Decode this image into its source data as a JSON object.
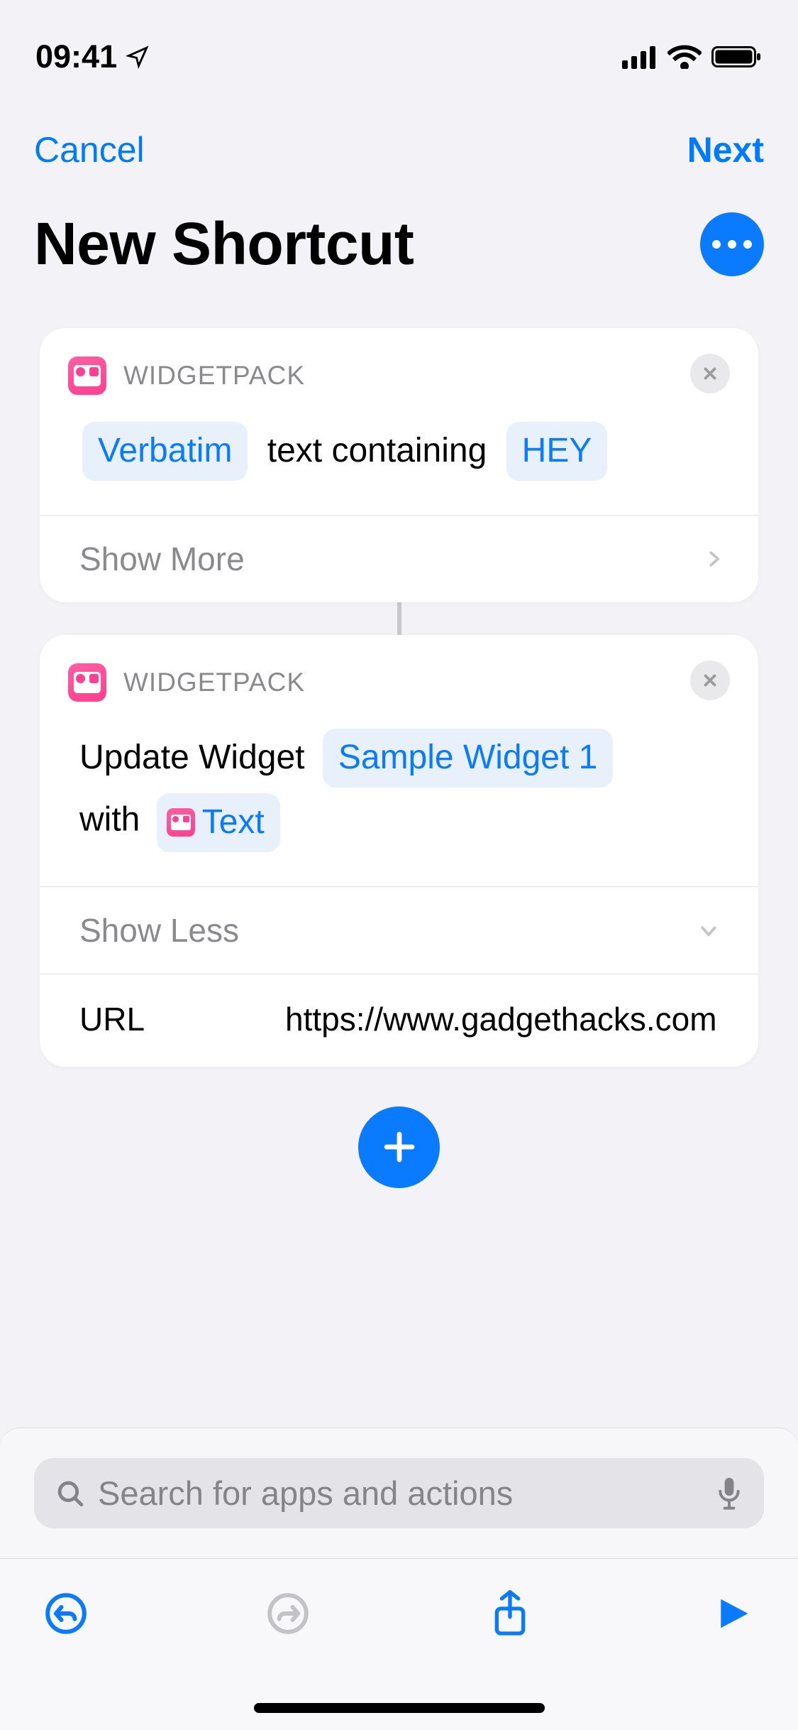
{
  "status": {
    "time": "09:41"
  },
  "nav": {
    "cancel": "Cancel",
    "next": "Next"
  },
  "title": "New Shortcut",
  "actions": [
    {
      "app_label": "WIDGETPACK",
      "token_mode": "Verbatim",
      "middle_text": "text containing",
      "token_value": "HEY",
      "expand_label": "Show More"
    },
    {
      "app_label": "WIDGETPACK",
      "prefix_text": "Update Widget",
      "token_widget": "Sample Widget 1",
      "with_text": "with",
      "token_content": "Text",
      "expand_label": "Show Less",
      "param_key": "URL",
      "param_val": "https://www.gadgethacks.com"
    }
  ],
  "search": {
    "placeholder": "Search for apps and actions"
  }
}
